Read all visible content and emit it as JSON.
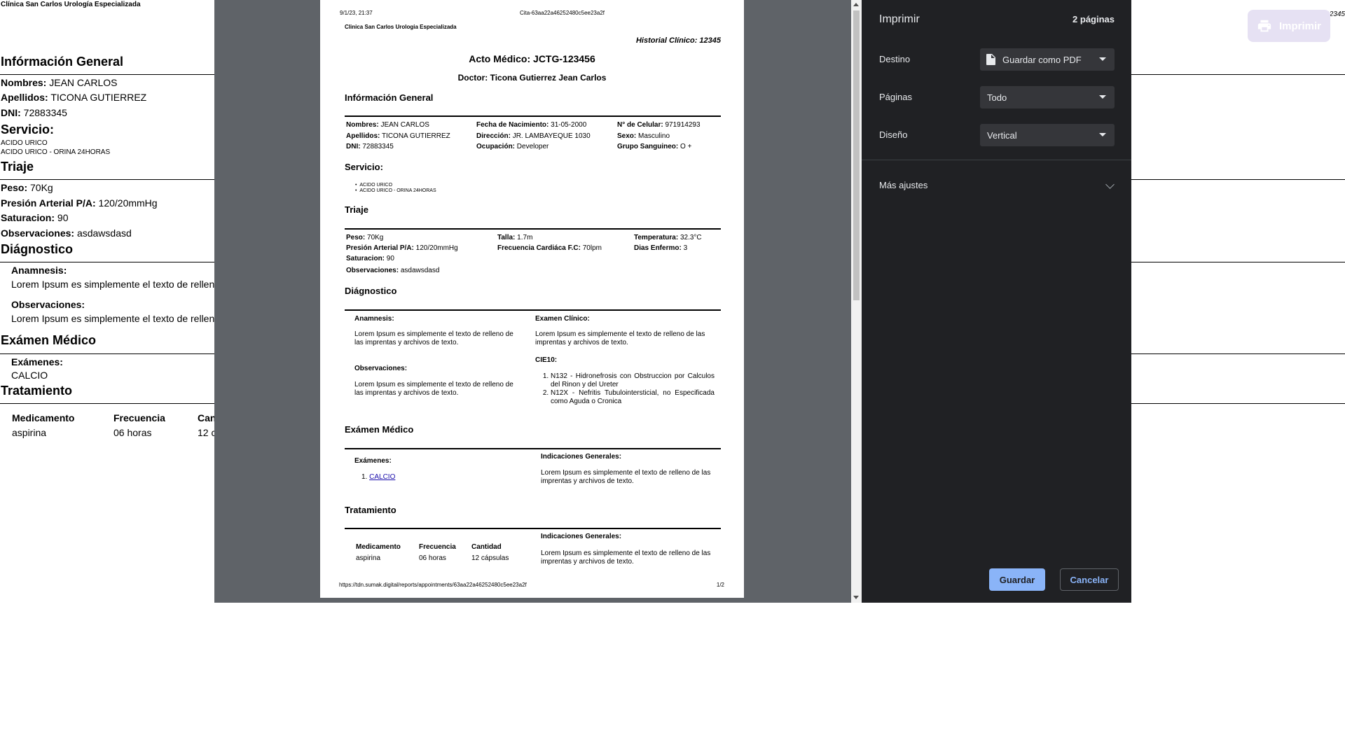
{
  "background": {
    "clinic": "Clínica San Carlos Urología Especializada",
    "historial_right": "12345",
    "print_button": "Imprimir",
    "info_title": "Infórmación General",
    "nombres_label": "Nombres:",
    "nombres": "JEAN CARLOS",
    "apellidos_label": "Apellidos:",
    "apellidos": "TICONA GUTIERREZ",
    "dni_label": "DNI:",
    "dni": "72883345",
    "servicio_title": "Servicio:",
    "servicios": [
      "ACIDO URICO",
      "ACIDO URICO - ORINA 24HORAS"
    ],
    "triaje_title": "Triaje",
    "peso_label": "Peso:",
    "peso": "70Kg",
    "presion_label": "Presión Arterial P/A:",
    "presion": "120/20mmHg",
    "saturacion_label": "Saturacion:",
    "saturacion": "90",
    "observaciones_label": "Observaciones:",
    "observaciones": "asdawsdasd",
    "diagnostico_title": "Diágnostico",
    "anamnesis_label": "Anamnesis:",
    "anamnesis_text": "Lorem Ipsum es simplemente el texto de rellen",
    "obs_label": "Observaciones:",
    "obs_text": "Lorem Ipsum es simplemente el texto de rellen",
    "examen_title": "Exámen Médico",
    "examenes_label": "Exámenes:",
    "examen_item": "CALCIO",
    "tratamiento_title": "Tratamiento",
    "col_medicamento": "Medicamento",
    "col_frecuencia": "Frecuencia",
    "col_cantidad": "Can",
    "medicamento": "aspirina",
    "frecuencia": "06 horas",
    "cantidad": "12 c"
  },
  "preview": {
    "header_date": "9/1/23, 21:37",
    "header_title": "Cita-63aa22a46252480c5ee23a2f",
    "clinic": "Clinica San Carlos Urologia Especializada",
    "historial": "Historial Clínico: 12345",
    "acto": "Acto Médico: JCTG-123456",
    "doctor": "Doctor: Ticona Gutierrez Jean Carlos",
    "info_title": "Infórmación General",
    "nombres_label": "Nombres:",
    "nombres": "JEAN CARLOS",
    "apellidos_label": "Apellidos:",
    "apellidos": "TICONA GUTIERREZ",
    "dni_label": "DNI:",
    "dni": "72883345",
    "fnac_label": "Fecha de Nacimiento:",
    "fnac": "31-05-2000",
    "dir_label": "Dirección:",
    "dir": "JR. LAMBAYEQUE 1030",
    "ocup_label": "Ocupación:",
    "ocup": "Developer",
    "cel_label": "N° de Celular:",
    "cel": "971914293",
    "sexo_label": "Sexo:",
    "sexo": "Masculino",
    "grupo_label": "Grupo Sanguineo:",
    "grupo": "O +",
    "servicio_title": "Servicio:",
    "servicios": [
      "ACIDO URICO",
      "ACIDO URICO - ORINA 24HORAS"
    ],
    "triaje_title": "Triaje",
    "peso_label": "Peso:",
    "peso": "70Kg",
    "presion_label": "Presión Arterial P/A:",
    "presion": "120/20mmHg",
    "saturacion_label": "Saturacion:",
    "saturacion": "90",
    "talla_label": "Talla:",
    "talla": "1.7m",
    "fc_label": "Frecuencia Cardiáca F.C:",
    "fc": "70lpm",
    "temp_label": "Temperatura:",
    "temp": "32.3°C",
    "dias_label": "Dias Enfermo:",
    "dias": "3",
    "observaciones_label": "Observaciones:",
    "observaciones": "asdawsdasd",
    "diagnostico_title": "Diágnostico",
    "anamnesis_label": "Anamnesis:",
    "lorem": "Lorem Ipsum es simplemente el texto de relleno de las imprentas y archivos de texto.",
    "obs_label": "Observaciones:",
    "examen_clinico_label": "Examen Clínico:",
    "cie10_label": "CIE10:",
    "cie10": [
      "N132 - Hidronefrosis con Obstruccion por Calculos del Rinon y del Ureter",
      "N12X - Nefritis Tubulointersticial, no Especificada como Aguda o Cronica"
    ],
    "examen_title": "Exámen Médico",
    "examenes_label": "Exámenes:",
    "examen_item": "CALCIO",
    "indicaciones_label": "Indicaciones Generales:",
    "tratamiento_title": "Tratamiento",
    "col_medicamento": "Medicamento",
    "col_frecuencia": "Frecuencia",
    "col_cantidad": "Cantidad",
    "medicamento": "aspirina",
    "frecuencia": "06 horas",
    "cantidad": "12 cápsulas",
    "footer_url": "https://tdn.sumak.digital/reports/appointments/63aa22a46252480c5ee23a2f",
    "footer_page": "1/2"
  },
  "panel": {
    "title": "Imprimir",
    "pages": "2 páginas",
    "destino_label": "Destino",
    "destino_value": "Guardar como PDF",
    "paginas_label": "Páginas",
    "paginas_value": "Todo",
    "diseno_label": "Diseño",
    "diseno_value": "Vertical",
    "more": "Más ajustes",
    "save": "Guardar",
    "cancel": "Cancelar"
  },
  "colors": {
    "panel_bg": "#202124",
    "accent": "#8ab4f8",
    "preview_bg": "#5f6368"
  }
}
